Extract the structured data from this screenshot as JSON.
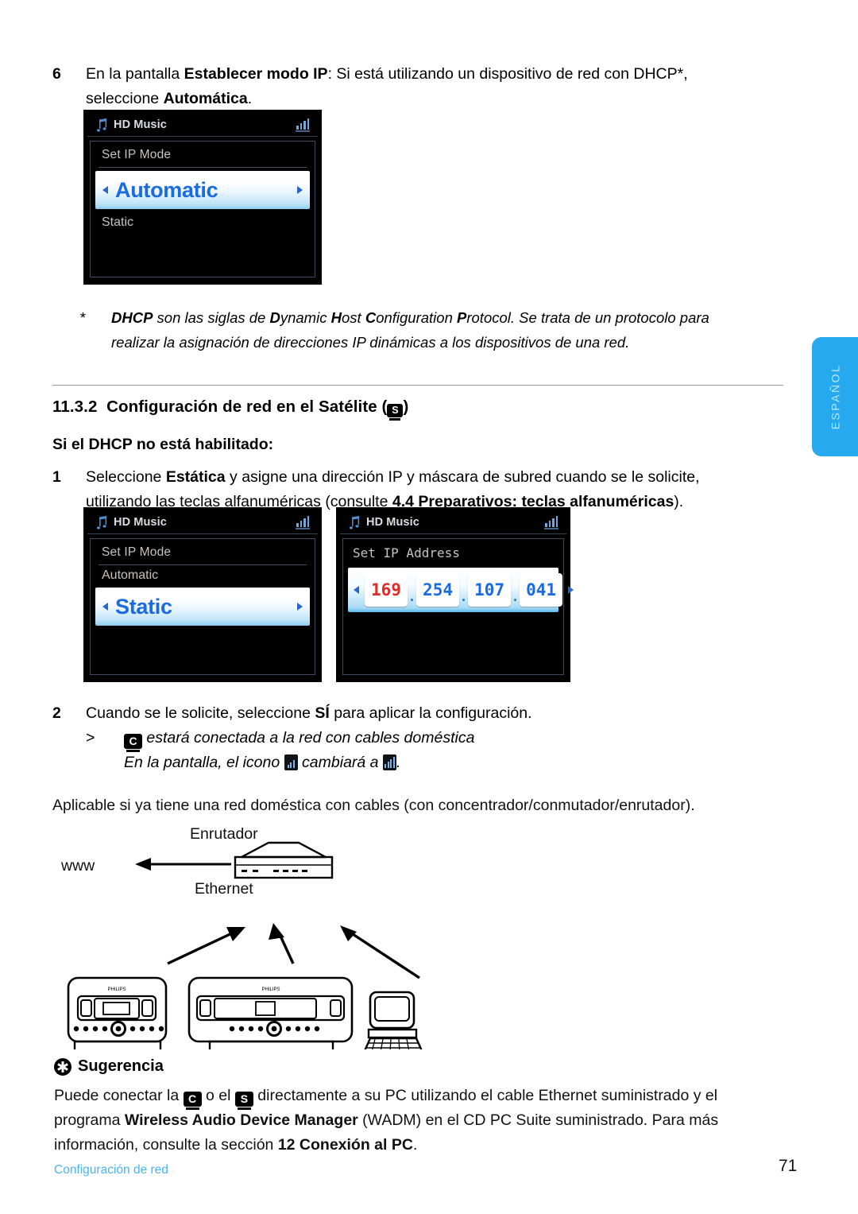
{
  "page": {
    "number": "71",
    "footer_label": "Configuración de red",
    "side_tab": "ESPAÑOL"
  },
  "step6": {
    "number": "6",
    "text_part1": "En la pantalla ",
    "bold1": "Establecer modo IP",
    "text_part2": ": Si está utilizando un dispositivo de red con DHCP*,",
    "text_part3": "seleccione ",
    "bold2": "Automática",
    "text_part4": "."
  },
  "footnote": {
    "mark": "*",
    "dhcp": "DHCP",
    "t1": " son las siglas de ",
    "d": "D",
    "ynamic": "ynamic ",
    "h": "H",
    "ost": "ost ",
    "c": "C",
    "onfiguration": "onfiguration ",
    "p": "P",
    "rotocol": "rotocol",
    "t2": ". Se trata de un protocolo para",
    "line2": "realizar la asignación de direcciones IP dinámicas a los dispositivos de una red."
  },
  "heading": {
    "number": "11.3.2",
    "title": "Configuración de red en el Satélite (",
    "badge": "S",
    "title_end": ")"
  },
  "subheading": {
    "text": "Si el DHCP no está habilitado:"
  },
  "step1": {
    "number": "1",
    "t1": "Seleccione ",
    "b1": "Estática",
    "t2": " y asigne una dirección IP y máscara de subred cuando se le solicite,",
    "t3": "utilizando las teclas alfanuméricas (consulte ",
    "b2": "4.4 Preparativos: teclas alfanuméricas",
    "t4": ")."
  },
  "step2": {
    "number": "2",
    "t1": "Cuando se le solicite, seleccione ",
    "b1": "SÍ",
    "t2": " para aplicar la configuración.",
    "bullet": ">",
    "sub_badge": "C",
    "sub_t1": " estará conectada a la red con cables doméstica",
    "sub_t2": "En la pantalla, el icono ",
    "sub_t3": " cambiará a ",
    "sub_t4": "."
  },
  "applicable": {
    "text": "Aplicable si ya tiene una red doméstica con cables (con concentrador/conmutador/enrutador)."
  },
  "screens": [
    {
      "id": "set-ip-mode-automatic",
      "title": "HD Music",
      "label": "Set IP Mode",
      "selected": "Automatic",
      "selected_position": "first",
      "other": "Static"
    },
    {
      "id": "set-ip-mode-static",
      "title": "HD Music",
      "label": "Set IP Mode",
      "selected": "Static",
      "selected_position": "second",
      "other": "Automatic"
    },
    {
      "id": "set-ip-address",
      "title": "HD Music",
      "label": "Set IP Address",
      "octets": [
        "169",
        "254",
        "107",
        "041"
      ],
      "active_octet_index": 0,
      "separator": "."
    }
  ],
  "diagram": {
    "www_label": "www",
    "router_label": "Enrutador",
    "ethernet_label": "Ethernet",
    "device_brand": "PHILIPS"
  },
  "tip": {
    "heading": "Sugerencia",
    "t1": "Puede conectar la ",
    "badge1": "C",
    "t2": " o el ",
    "badge2": "S",
    "t3": " directamente a su PC utilizando el cable Ethernet suministrado y el",
    "t4": "programa ",
    "b1": "Wireless Audio Device Manager",
    "t5": " (WADM) en el CD PC Suite suministrado. Para más",
    "t6": "información, consulte la sección ",
    "b2": "12 Conexión al PC",
    "t7": "."
  },
  "colors": {
    "accent_blue": "#26a9ee",
    "footer_blue": "#4ab4f0",
    "lcd_bg": "#000000",
    "lcd_select_text": "#1a6ae0",
    "lcd_active_octet": "#e02b2b"
  }
}
